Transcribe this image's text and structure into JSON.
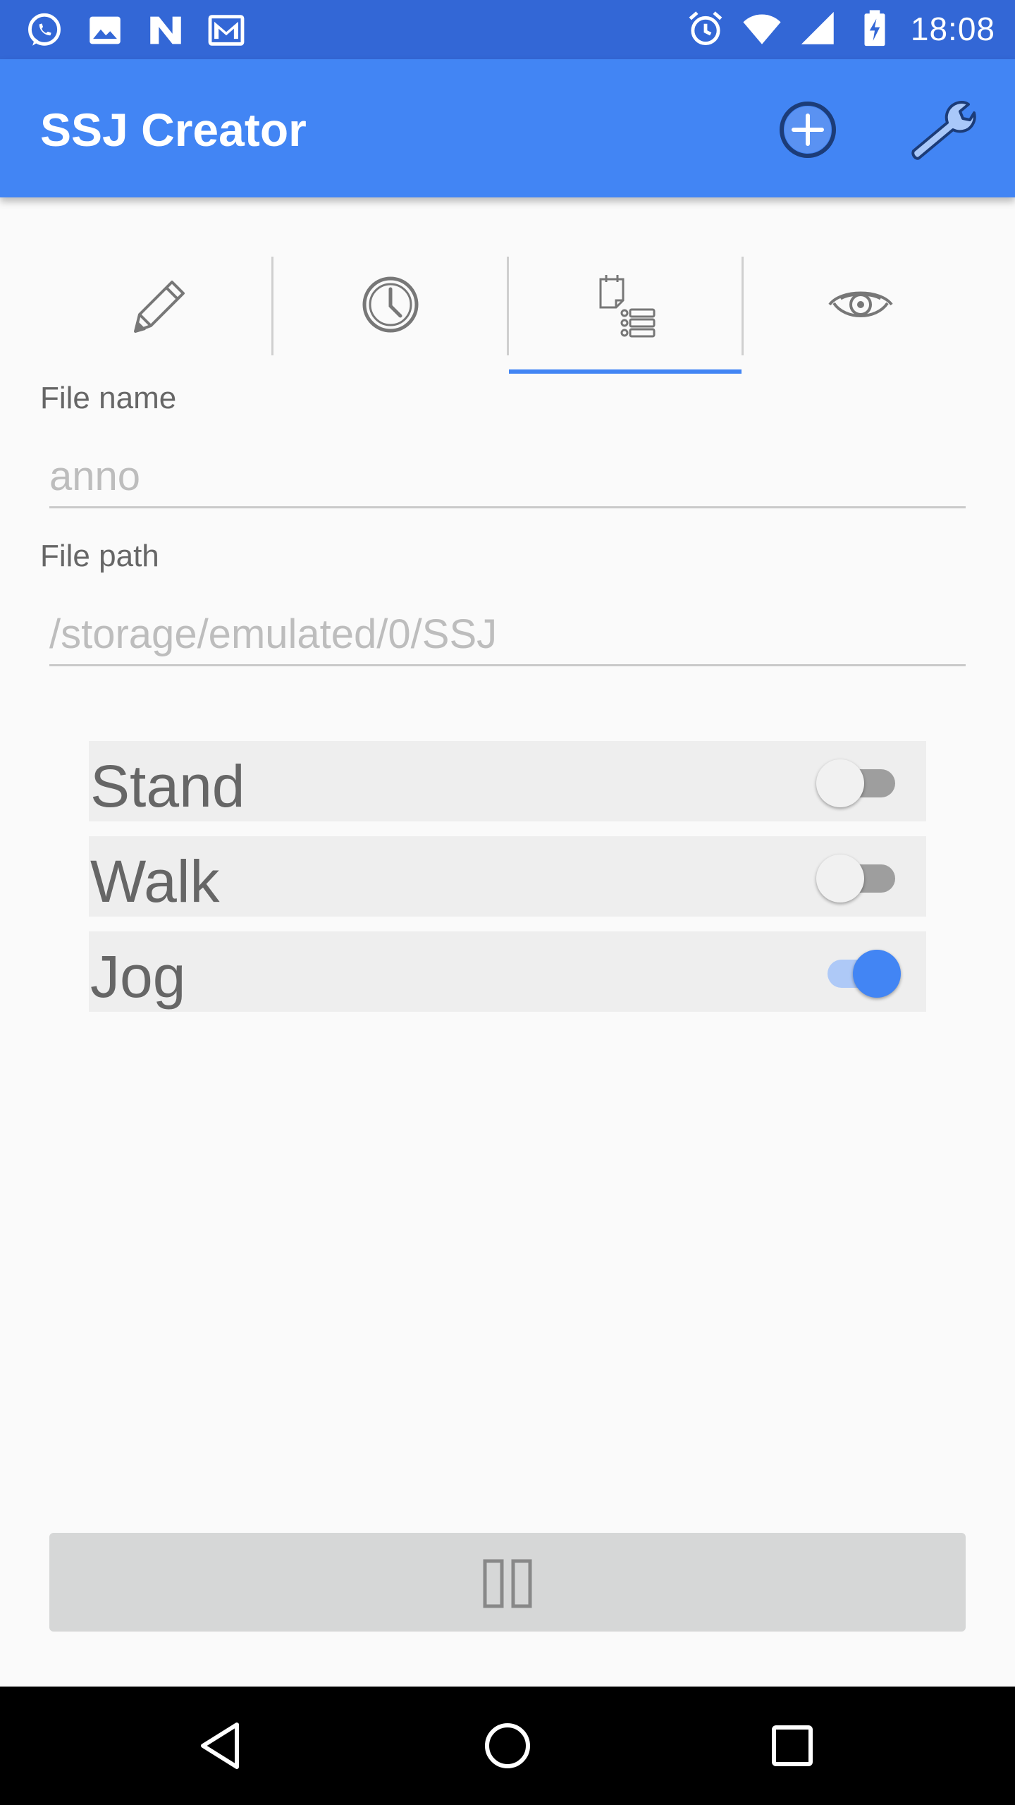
{
  "status_bar": {
    "time": "18:08",
    "left_icons": [
      "whatsapp-icon",
      "image-icon",
      "n-app-icon",
      "gmail-icon"
    ],
    "right_icons": [
      "alarm-icon",
      "wifi-icon",
      "signal-icon",
      "battery-charging-icon"
    ]
  },
  "app_bar": {
    "title": "SSJ Creator",
    "actions": [
      "add-circle-icon",
      "wrench-icon"
    ],
    "color": "#4285f4"
  },
  "tabs": [
    {
      "icon": "pencil-icon"
    },
    {
      "icon": "clock-icon"
    },
    {
      "icon": "annotation-list-icon",
      "selected": true
    },
    {
      "icon": "eye-icon"
    }
  ],
  "form": {
    "file_name": {
      "label": "File name",
      "placeholder": "anno"
    },
    "file_path": {
      "label": "File path",
      "placeholder": "/storage/emulated/0/SSJ"
    }
  },
  "annotations": [
    {
      "label": "Stand",
      "enabled": false
    },
    {
      "label": "Walk",
      "enabled": false
    },
    {
      "label": "Jog",
      "enabled": true
    }
  ],
  "bottom_button": {
    "icon": "pause-icon"
  },
  "nav_bar": {
    "buttons": [
      "back-icon",
      "home-icon",
      "recent-apps-icon"
    ]
  }
}
